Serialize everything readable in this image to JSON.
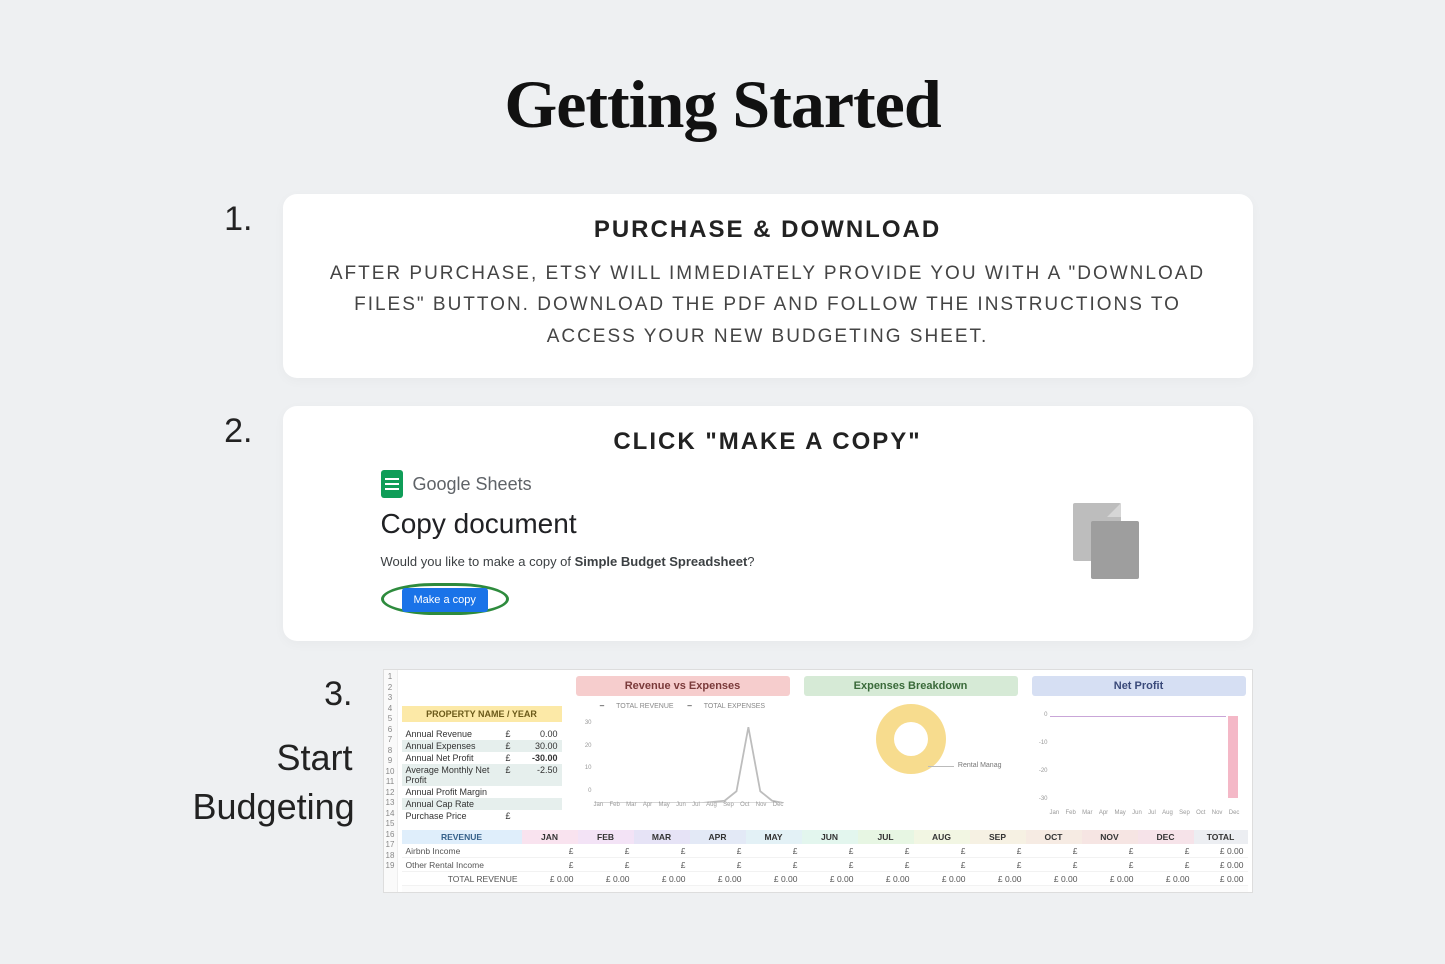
{
  "title": "Getting Started",
  "steps": {
    "one": {
      "num": "1.",
      "card_title": "PURCHASE & DOWNLOAD",
      "card_body": "AFTER PURCHASE, ETSY WILL IMMEDIATELY PROVIDE YOU WITH A \"DOWNLOAD FILES\" BUTTON. DOWNLOAD THE PDF AND FOLLOW THE INSTRUCTIONS TO ACCESS YOUR NEW BUDGETING SHEET."
    },
    "two": {
      "num": "2.",
      "card_title": "CLICK \"MAKE A COPY\"",
      "gs_label": "Google Sheets",
      "copy_heading": "Copy document",
      "copy_question_prefix": "Would you like to make a copy of ",
      "copy_question_bold": "Simple Budget Spreadsheet",
      "copy_question_suffix": "?",
      "copy_button": "Make a copy"
    },
    "three": {
      "num": "3.",
      "label_line1": "Start",
      "label_line2": "Budgeting",
      "row_numbers": [
        "1",
        "2",
        "3",
        "4",
        "5",
        "6",
        "7",
        "8",
        "9",
        "10",
        "11",
        "12",
        "13",
        "14",
        "15",
        "16",
        "17",
        "18",
        "19"
      ],
      "property_header": "PROPERTY NAME / YEAR",
      "metrics": [
        {
          "label": "Annual Revenue",
          "cur": "£",
          "val": "0.00"
        },
        {
          "label": "Annual Expenses",
          "cur": "£",
          "val": "30.00"
        },
        {
          "label": "Annual Net Profit",
          "cur": "£",
          "val": "-30.00"
        },
        {
          "label": "Average Monthly Net Profit",
          "cur": "£",
          "val": "-2.50"
        },
        {
          "label": "Annual Profit Margin",
          "cur": "",
          "val": ""
        },
        {
          "label": "Annual Cap Rate",
          "cur": "",
          "val": ""
        },
        {
          "label": "Purchase Price",
          "cur": "£",
          "val": ""
        }
      ],
      "charts": {
        "revexp": {
          "title": "Revenue vs Expenses",
          "legend": [
            "TOTAL REVENUE",
            "TOTAL EXPENSES"
          ],
          "y_ticks": [
            "30",
            "20",
            "10",
            "0"
          ],
          "months": [
            "Jan",
            "Feb",
            "Mar",
            "Apr",
            "May",
            "Jun",
            "Jul",
            "Aug",
            "Sep",
            "Oct",
            "Nov",
            "Dec"
          ]
        },
        "expbreak": {
          "title": "Expenses Breakdown",
          "slice_label": "Rental Manag"
        },
        "netprofit": {
          "title": "Net Profit",
          "y_ticks": [
            "0",
            "-10",
            "-20",
            "-30"
          ],
          "months": [
            "Jan",
            "Feb",
            "Mar",
            "Apr",
            "May",
            "Jun",
            "Jul",
            "Aug",
            "Sep",
            "Oct",
            "Nov",
            "Dec"
          ]
        }
      },
      "month_headers": [
        "REVENUE",
        "JAN",
        "FEB",
        "MAR",
        "APR",
        "MAY",
        "JUN",
        "JUL",
        "AUG",
        "SEP",
        "OCT",
        "NOV",
        "DEC",
        "TOTAL"
      ],
      "revenue_rows": [
        {
          "label": "Airbnb Income",
          "cells": [
            "£",
            "£",
            "£",
            "£",
            "£",
            "£",
            "£",
            "£",
            "£",
            "£",
            "£",
            "£"
          ],
          "total": "£      0.00"
        },
        {
          "label": "Other Rental Income",
          "cells": [
            "£",
            "£",
            "£",
            "£",
            "£",
            "£",
            "£",
            "£",
            "£",
            "£",
            "£",
            "£"
          ],
          "total": "£      0.00"
        }
      ],
      "total_revenue_label": "TOTAL REVENUE",
      "total_revenue_cells": [
        "£    0.00",
        "£    0.00",
        "£    0.00",
        "£    0.00",
        "£    0.00",
        "£    0.00",
        "£    0.00",
        "£    0.00",
        "£    0.00",
        "£    0.00",
        "£    0.00",
        "£    0.00"
      ],
      "total_revenue_total": "£      0.00"
    }
  }
}
